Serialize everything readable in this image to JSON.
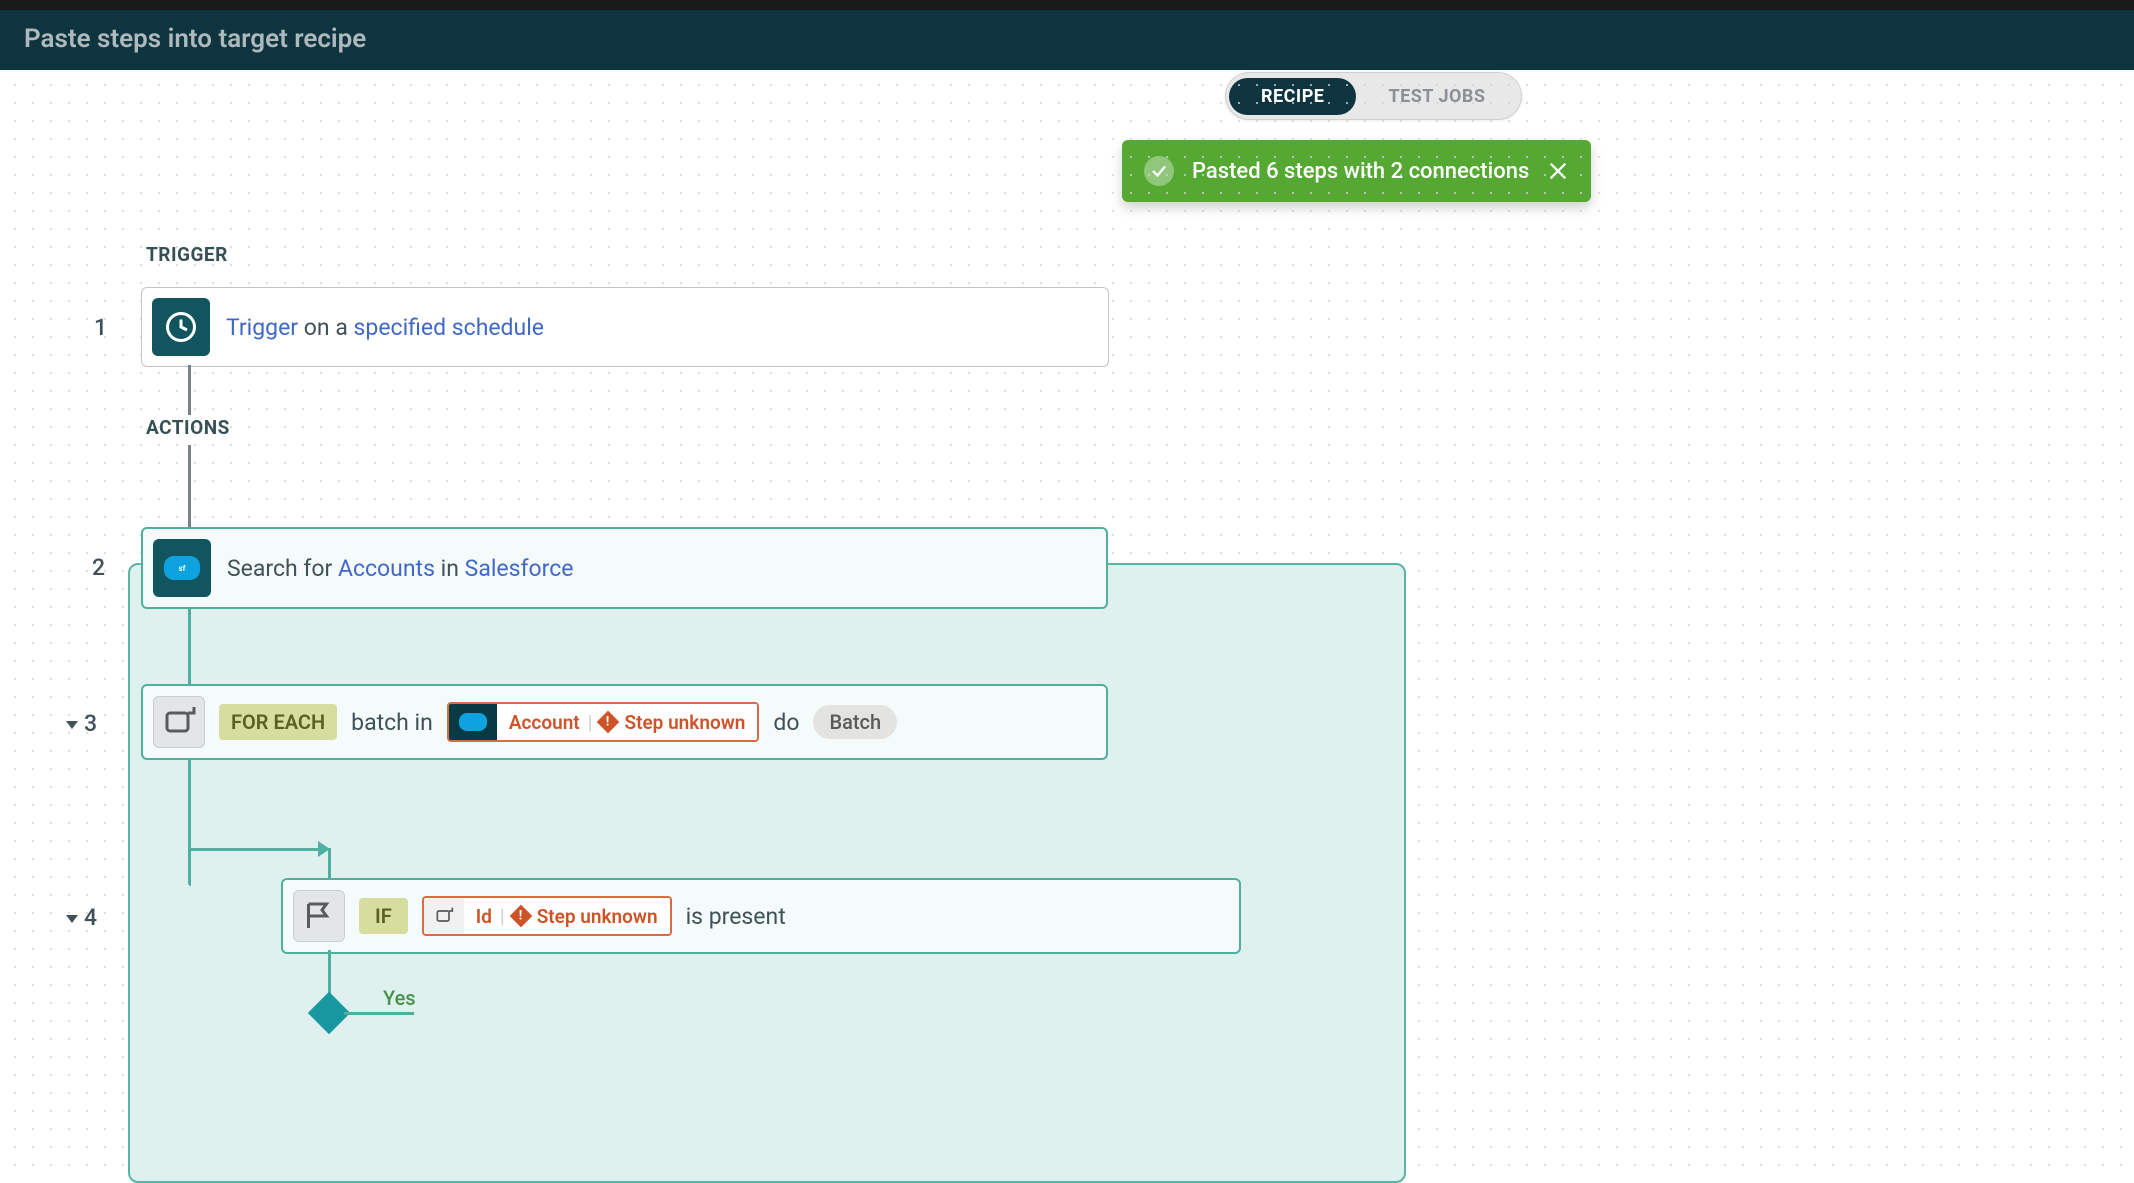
{
  "header": {
    "title": "Paste steps into target recipe"
  },
  "tabs": {
    "recipe": "RECIPE",
    "testjobs": "TEST JOBS"
  },
  "toast": {
    "message": "Pasted 6 steps with 2 connections"
  },
  "labels": {
    "trigger": "TRIGGER",
    "actions": "ACTIONS"
  },
  "step1": {
    "num": "1",
    "prefix": "Trigger",
    "mid": " on a ",
    "suffix": "specified schedule"
  },
  "step2": {
    "num": "2",
    "prefix": "Search for ",
    "accounts": "Accounts",
    "in": " in ",
    "sf": "Salesforce"
  },
  "step3": {
    "num": "3",
    "foreach": "FOR EACH",
    "batchin": "batch in",
    "account": "Account",
    "stepunknown": "Step unknown",
    "do": "do",
    "batch": "Batch"
  },
  "step4": {
    "num": "4",
    "if": "IF",
    "id": "Id",
    "stepunknown": "Step unknown",
    "ispresent": "is present"
  },
  "decision": {
    "yes": "Yes"
  }
}
